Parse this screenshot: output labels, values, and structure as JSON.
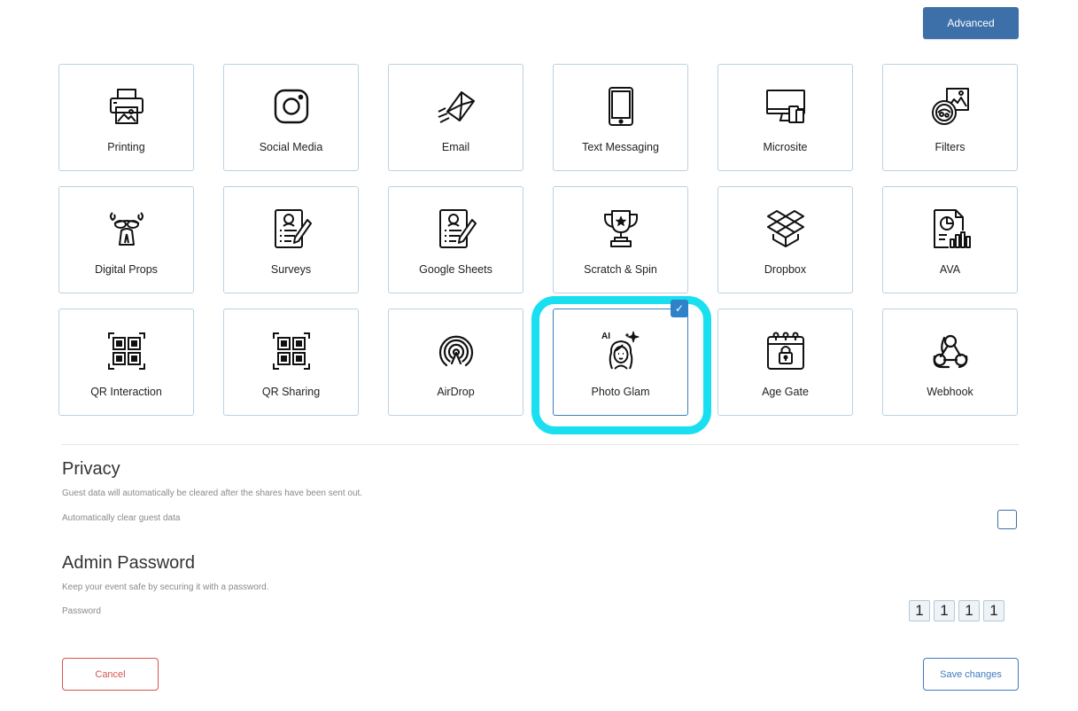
{
  "header": {
    "advanced_label": "Advanced"
  },
  "tiles": [
    {
      "label": "Printing",
      "icon": "printer-icon",
      "selected": false
    },
    {
      "label": "Social Media",
      "icon": "instagram-icon",
      "selected": false
    },
    {
      "label": "Email",
      "icon": "envelope-icon",
      "selected": false
    },
    {
      "label": "Text Messaging",
      "icon": "tablet-icon",
      "selected": false
    },
    {
      "label": "Microsite",
      "icon": "desktop-devices-icon",
      "selected": false
    },
    {
      "label": "Filters",
      "icon": "filters-icon",
      "selected": false
    },
    {
      "label": "Digital Props",
      "icon": "props-icon",
      "selected": false
    },
    {
      "label": "Surveys",
      "icon": "survey-form-icon",
      "selected": false
    },
    {
      "label": "Google Sheets",
      "icon": "sheets-form-icon",
      "selected": false
    },
    {
      "label": "Scratch & Spin",
      "icon": "trophy-icon",
      "selected": false
    },
    {
      "label": "Dropbox",
      "icon": "dropbox-icon",
      "selected": false
    },
    {
      "label": "AVA",
      "icon": "analytics-report-icon",
      "selected": false
    },
    {
      "label": "QR Interaction",
      "icon": "qr-code-icon",
      "selected": false
    },
    {
      "label": "QR Sharing",
      "icon": "qr-code-icon",
      "selected": false
    },
    {
      "label": "AirDrop",
      "icon": "airdrop-icon",
      "selected": false
    },
    {
      "label": "Photo Glam",
      "icon": "ai-face-icon",
      "ai_text": "AI",
      "selected": true
    },
    {
      "label": "Age Gate",
      "icon": "calendar-lock-icon",
      "selected": false
    },
    {
      "label": "Webhook",
      "icon": "webhook-icon",
      "selected": false
    }
  ],
  "privacy": {
    "title": "Privacy",
    "description": "Guest data will automatically be cleared after the shares have been sent out.",
    "field_label": "Automatically clear guest data",
    "checked": false
  },
  "admin_password": {
    "title": "Admin Password",
    "description": "Keep your event safe by securing it with a password.",
    "field_label": "Password",
    "digits": [
      "1",
      "1",
      "1",
      "1"
    ]
  },
  "footer": {
    "cancel_label": "Cancel",
    "save_label": "Save changes"
  },
  "colors": {
    "primary": "#3d6fa8",
    "highlight": "#19dff0",
    "cancel": "#d9534f",
    "tile_border": "#b9d2e0"
  }
}
